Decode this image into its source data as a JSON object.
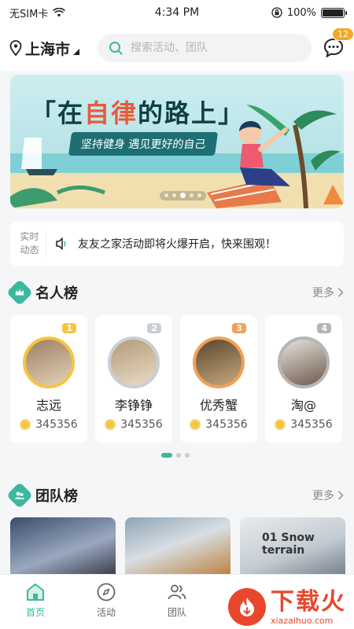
{
  "status": {
    "carrier": "无SIM卡",
    "time": "4:34 PM",
    "battery": "100%",
    "battery_level": 1.0
  },
  "header": {
    "city": "上海市",
    "search_placeholder": "搜索活动、团队",
    "message_badge": "12"
  },
  "banner": {
    "title_part1": "在",
    "title_highlight": "自律",
    "title_part2": "的路上",
    "subtitle": "坚持健身 遇见更好的自己",
    "active_slide": 3,
    "slide_count": 5
  },
  "news": {
    "tag_line1": "实时",
    "tag_line2": "动态",
    "text": "友友之家活动即将火爆开启，快来围观！"
  },
  "celebrity": {
    "title": "名人榜",
    "more": "更多",
    "items": [
      {
        "rank": "1",
        "name": "志远",
        "score": "345356",
        "ring": "#f5c542"
      },
      {
        "rank": "2",
        "name": "李铮铮",
        "score": "345356",
        "ring": "#c9ced6"
      },
      {
        "rank": "3",
        "name": "优秀蟹",
        "score": "345356",
        "ring": "#f0a25a"
      },
      {
        "rank": "4",
        "name": "淘@",
        "score": "345356",
        "ring": "#b5b5b5"
      }
    ]
  },
  "team": {
    "title": "团队榜",
    "more": "更多",
    "thumb3_label": "01 Snow terrain"
  },
  "tabs": [
    {
      "label": "首页",
      "active": true
    },
    {
      "label": "活动",
      "active": false
    },
    {
      "label": "团队",
      "active": false
    }
  ],
  "watermark": {
    "big": "下载火",
    "small": "xiazaihuo.com"
  },
  "colors": {
    "accent": "#3bb89e",
    "badge": "#f5a623",
    "watermark": "#e8472d"
  }
}
